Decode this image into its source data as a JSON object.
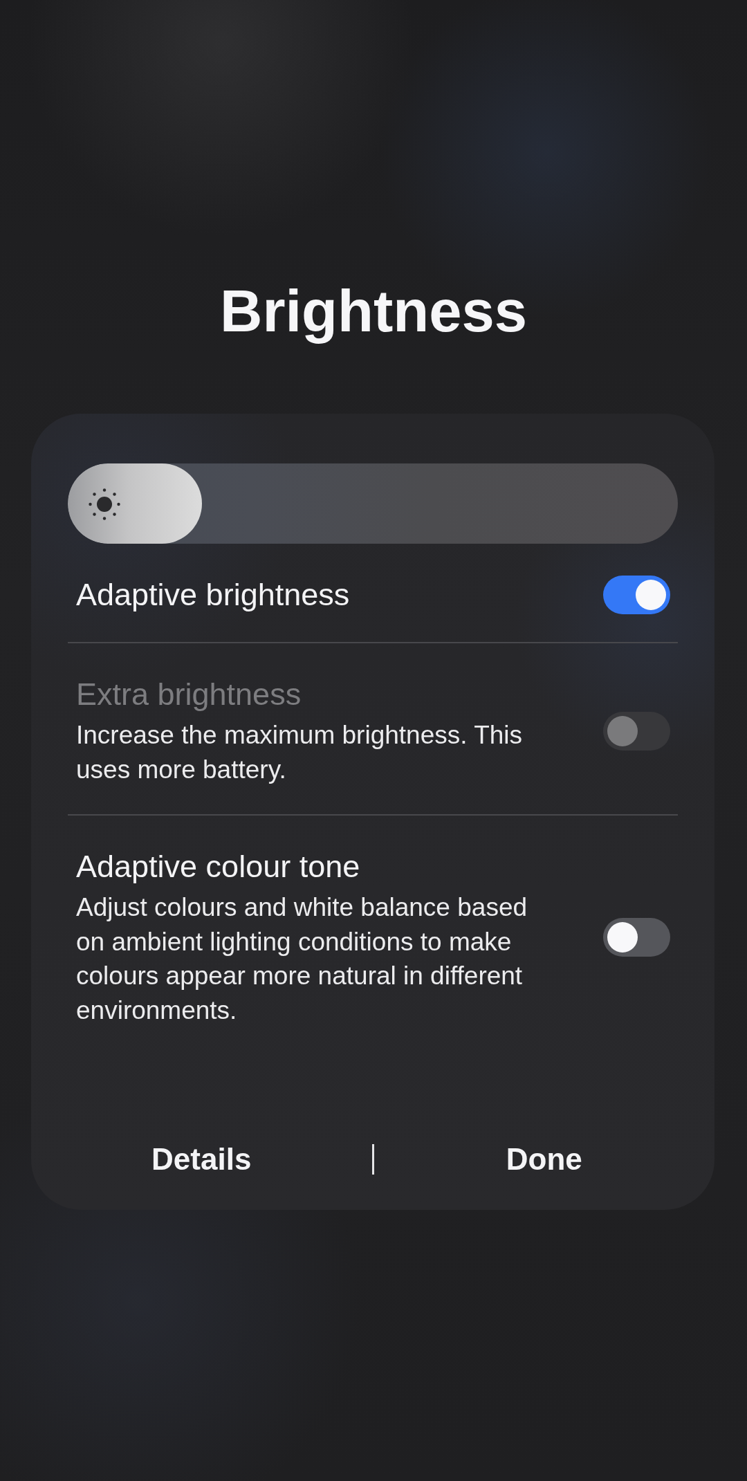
{
  "title": "Brightness",
  "brightness": {
    "level": 0.22
  },
  "settings": [
    {
      "title": "Adaptive brightness",
      "on": true,
      "disabled": false
    },
    {
      "title": "Extra brightness",
      "description": "Increase the maximum brightness. This uses more battery.",
      "on": false,
      "disabled": true
    },
    {
      "title": "Adaptive colour tone",
      "description": "Adjust colours and white balance based on ambient lighting conditions to make colours appear more natural in different environments.",
      "on": false,
      "disabled": false
    }
  ],
  "buttons": [
    {
      "label": "Details"
    },
    {
      "label": "Done"
    }
  ]
}
